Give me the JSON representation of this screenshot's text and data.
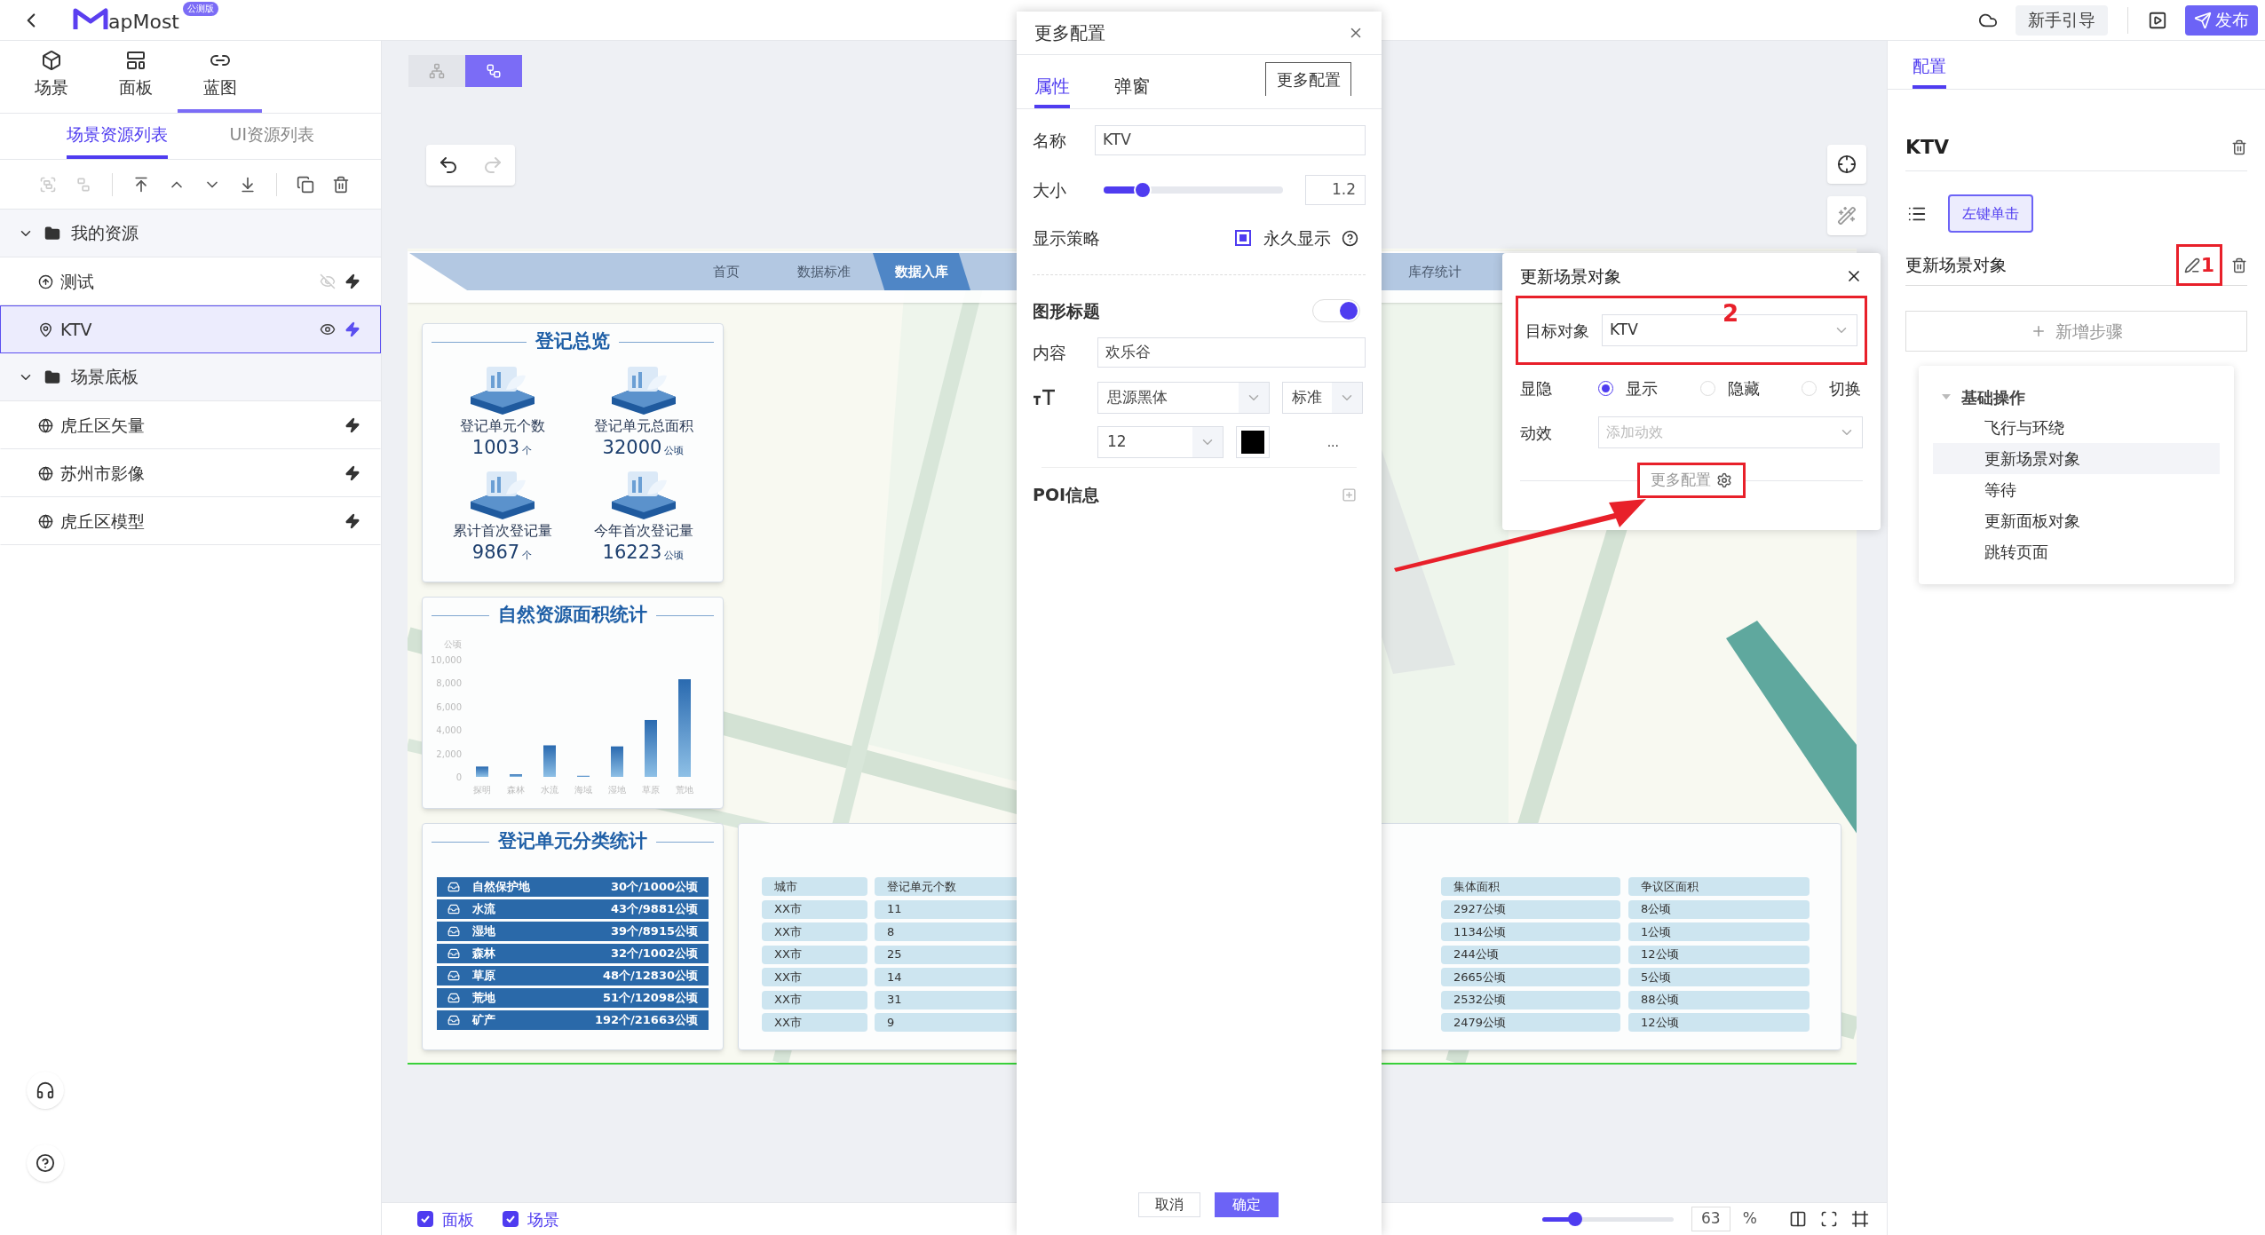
{
  "top_bar": {
    "logo_text": "apMost",
    "badge": "公测版",
    "guide_button": "新手引导",
    "publish_button": "发布"
  },
  "left_panel": {
    "main_tabs": [
      {
        "label": "场景",
        "kind": "scene",
        "selected": false
      },
      {
        "label": "面板",
        "kind": "panel",
        "selected": false
      },
      {
        "label": "蓝图",
        "kind": "blueprint",
        "selected": true
      }
    ],
    "sub_tabs": [
      {
        "label": "场景资源列表",
        "selected": true
      },
      {
        "label": "UI资源列表",
        "selected": false
      }
    ],
    "toolbar": [
      {
        "kind": "group",
        "disabled": true
      },
      {
        "kind": "ungroup",
        "disabled": true
      },
      {
        "kind": "top",
        "disabled": false
      },
      {
        "kind": "up",
        "disabled": false
      },
      {
        "kind": "down",
        "disabled": false
      },
      {
        "kind": "bottom",
        "disabled": false
      },
      {
        "kind": "copy",
        "disabled": false
      },
      {
        "kind": "delete",
        "disabled": false
      }
    ],
    "tree": [
      {
        "label": "我的资源",
        "expanded": true,
        "children": [
          {
            "label": "测试",
            "kind": "marker",
            "selected": false,
            "visible": false
          },
          {
            "label": "KTV",
            "kind": "poi",
            "selected": true,
            "visible": true
          }
        ]
      },
      {
        "label": "场景底板",
        "expanded": true,
        "children": [
          {
            "label": "虎丘区矢量",
            "kind": "layer",
            "selected": false
          },
          {
            "label": "苏州市影像",
            "kind": "layer",
            "selected": false
          },
          {
            "label": "虎丘区模型",
            "kind": "layer",
            "selected": false
          }
        ]
      }
    ]
  },
  "canvas": {
    "view_modes": [
      {
        "kind": "tree",
        "selected": false
      },
      {
        "kind": "blueprint",
        "selected": true
      }
    ],
    "undo": {
      "disabled": false
    },
    "redo": {
      "disabled": true
    }
  },
  "dashboard": {
    "nav": [
      {
        "label": "首页",
        "selected": false
      },
      {
        "label": "数据标准",
        "selected": false
      },
      {
        "label": "数据入库",
        "selected": true
      },
      {
        "label": "库存统计",
        "selected": false
      }
    ],
    "overview": {
      "title": "登记总览",
      "stats": [
        {
          "label": "登记单元个数",
          "value": "1003",
          "unit": "个"
        },
        {
          "label": "登记单元总面积",
          "value": "32000",
          "unit": "公顷"
        },
        {
          "label": "累计首次登记量",
          "value": "9867",
          "unit": "个"
        },
        {
          "label": "今年首次登记量",
          "value": "16223",
          "unit": "公顷"
        }
      ]
    },
    "area_chart": {
      "title": "自然资源面积统计",
      "chart_data": {
        "type": "bar",
        "ylabel": "公顷",
        "categories": [
          "探明",
          "森林",
          "水流",
          "海域",
          "湿地",
          "草原",
          "荒地"
        ],
        "values": [
          880,
          220,
          2690,
          90,
          2600,
          4850,
          8330
        ],
        "ylim": [
          0,
          10000
        ],
        "yticks": [
          0,
          {
            "value": 2000,
            "label": "2,000"
          },
          {
            "value": 4000,
            "label": "4,000"
          },
          {
            "value": 6000,
            "label": "6,000"
          },
          {
            "value": 8000,
            "label": "8,000"
          },
          {
            "value": 10000,
            "label": "10,000"
          }
        ]
      }
    },
    "classification": {
      "title": "登记单元分类统计",
      "rows": [
        {
          "name": "自然保护地",
          "value": "30个/1000公顷"
        },
        {
          "name": "水流",
          "value": "43个/9881公顷"
        },
        {
          "name": "湿地",
          "value": "39个/8915公顷"
        },
        {
          "name": "森林",
          "value": "32个/1002公顷"
        },
        {
          "name": "草原",
          "value": "48个/12830公顷"
        },
        {
          "name": "荒地",
          "value": "51个/12098公顷"
        },
        {
          "name": "矿产",
          "value": "192个/21663公顷"
        }
      ]
    },
    "city_table": {
      "columns": [
        "城市",
        "登记单元个数",
        "集体面积",
        "争议区面积"
      ],
      "rows": [
        [
          "XX市",
          "11",
          "2927公顷",
          "8公顷"
        ],
        [
          "XX市",
          "8",
          "1134公顷",
          "1公顷"
        ],
        [
          "XX市",
          "25",
          "244公顷",
          "12公顷"
        ],
        [
          "XX市",
          "14",
          "2665公顷",
          "5公顷"
        ],
        [
          "XX市",
          "31",
          "2532公顷",
          "88公顷"
        ],
        [
          "XX市",
          "9",
          "2479公顷",
          "12公顷"
        ]
      ]
    }
  },
  "config_dialog": {
    "title": "更多配置",
    "tabs": [
      {
        "label": "属性",
        "selected": true
      },
      {
        "label": "弹窗",
        "selected": false
      }
    ],
    "tooltip": "更多配置",
    "name": {
      "label": "名称",
      "value": "KTV"
    },
    "size": {
      "label": "大小",
      "level": 0.22,
      "value": "1.2"
    },
    "display": {
      "label": "显示策略",
      "option": "永久显示",
      "checked": true
    },
    "title_section": {
      "label": "图形标题",
      "on": true,
      "content_label": "内容",
      "content": "欢乐谷",
      "font": "思源黑体",
      "weight": "标准",
      "font_size": "12",
      "color": "#000000",
      "more": "..."
    },
    "poi": {
      "label": "POI信息"
    },
    "cancel": "取消",
    "ok": "确定"
  },
  "step_popover": {
    "title": "更新场景对象",
    "target": {
      "label": "目标对象",
      "value": "KTV"
    },
    "annotation": "2",
    "visibility": {
      "label": "显隐",
      "options": [
        {
          "label": "显示",
          "selected": true
        },
        {
          "label": "隐藏",
          "selected": false
        },
        {
          "label": "切换",
          "selected": false
        }
      ]
    },
    "effect": {
      "label": "动效",
      "placeholder": "添加动效"
    },
    "more_link": {
      "label": "更多配置",
      "highlighted": true
    }
  },
  "right_panel": {
    "tabs": [
      {
        "label": "配置",
        "selected": true
      }
    ],
    "object_name": "KTV",
    "event": "左键单击",
    "step": {
      "label": "更新场景对象",
      "annotation": "1"
    },
    "add_step": "新增步骤",
    "menu": {
      "label": "基础操作",
      "expanded": true,
      "children": [
        {
          "label": "飞行与环绕",
          "selected": false
        },
        {
          "label": "更新场景对象",
          "selected": true
        },
        {
          "label": "等待",
          "selected": false
        },
        {
          "label": "更新面板对象",
          "selected": false
        },
        {
          "label": "跳转页面",
          "selected": false
        }
      ]
    }
  },
  "bottom_bar": {
    "checkboxes": [
      {
        "label": "面板",
        "checked": true
      },
      {
        "label": "场景",
        "checked": true
      }
    ],
    "zoom": {
      "level": 0.25,
      "value": "63",
      "unit": "%"
    }
  }
}
